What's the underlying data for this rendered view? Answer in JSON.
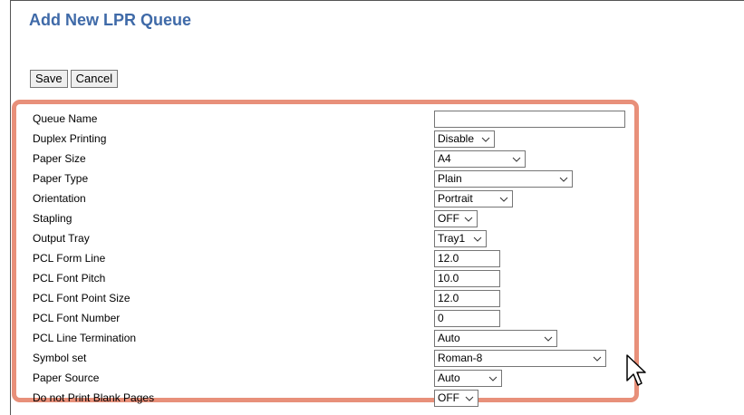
{
  "page": {
    "title": "Add New LPR Queue"
  },
  "toolbar": {
    "save_label": "Save",
    "cancel_label": "Cancel"
  },
  "form": {
    "rows": [
      {
        "label": "Queue Name",
        "kind": "text",
        "value": ""
      },
      {
        "label": "Duplex Printing",
        "kind": "select",
        "value": "Disable"
      },
      {
        "label": "Paper Size",
        "kind": "select",
        "value": "A4"
      },
      {
        "label": "Paper Type",
        "kind": "select",
        "value": "Plain"
      },
      {
        "label": "Orientation",
        "kind": "select",
        "value": "Portrait"
      },
      {
        "label": "Stapling",
        "kind": "select",
        "value": "OFF"
      },
      {
        "label": "Output Tray",
        "kind": "select",
        "value": "Tray1"
      },
      {
        "label": "PCL Form Line",
        "kind": "text",
        "value": "12.0"
      },
      {
        "label": "PCL Font Pitch",
        "kind": "text",
        "value": "10.0"
      },
      {
        "label": "PCL Font Point Size",
        "kind": "text",
        "value": "12.0"
      },
      {
        "label": "PCL Font Number",
        "kind": "text",
        "value": "0"
      },
      {
        "label": "PCL Line Termination",
        "kind": "select",
        "value": "Auto"
      },
      {
        "label": "Symbol set",
        "kind": "select",
        "value": "Roman-8"
      },
      {
        "label": "Paper Source",
        "kind": "select",
        "value": "Auto"
      },
      {
        "label": "Do not Print Blank Pages",
        "kind": "select",
        "value": "OFF"
      }
    ]
  },
  "colors": {
    "title": "#3f6aa8",
    "highlight_border": "#e8907a"
  },
  "icons": {
    "select_arrow": "chevron-down-icon",
    "cursor": "mouse-pointer-icon"
  }
}
